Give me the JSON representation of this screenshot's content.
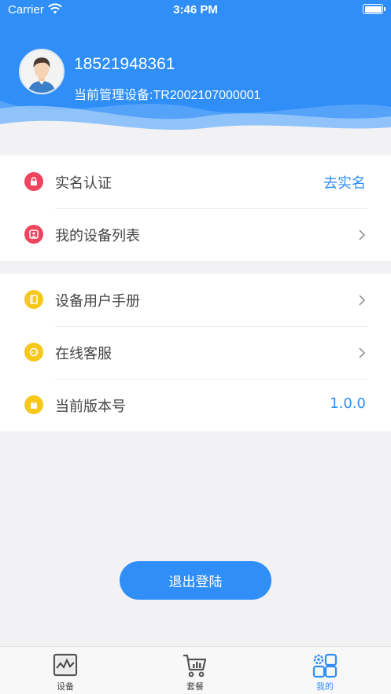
{
  "status_bar": {
    "carrier": "Carrier",
    "time": "3:46 PM"
  },
  "profile": {
    "phone": "18521948361",
    "device_line": "当前管理设备:TR2002107000001"
  },
  "menu": {
    "group1": [
      {
        "label": "实名认证",
        "value": "去实名",
        "icon": "lock-icon",
        "icon_color": "#f0435e"
      },
      {
        "label": "我的设备列表",
        "icon": "device-list-icon",
        "icon_color": "#f0435e"
      }
    ],
    "group2": [
      {
        "label": "设备用户手册",
        "icon": "manual-icon",
        "icon_color": "#f7c81c"
      },
      {
        "label": "在线客服",
        "icon": "support-icon",
        "icon_color": "#f7c81c"
      },
      {
        "label": "当前版本号",
        "value": "1.0.0",
        "icon": "version-icon",
        "icon_color": "#f7c81c"
      }
    ]
  },
  "logout_label": "退出登陆",
  "tabbar": {
    "items": [
      {
        "label": "设备",
        "icon": "device-chart-icon"
      },
      {
        "label": "套餐",
        "icon": "cart-icon"
      },
      {
        "label": "我的",
        "icon": "settings-grid-icon",
        "active": true
      }
    ]
  },
  "colors": {
    "primary": "#2f8ef7",
    "red_icon": "#f0435e",
    "yellow_icon": "#f7c81c"
  }
}
